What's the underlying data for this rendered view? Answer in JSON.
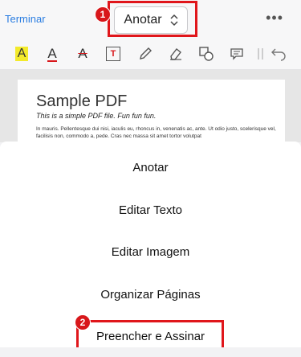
{
  "topbar": {
    "done_label": "Terminar",
    "mode_label": "Anotar",
    "more_label": "•••"
  },
  "toolbar": {
    "tools": [
      "highlight-icon",
      "text-color-icon",
      "strikethrough-icon",
      "text-box-icon",
      "pencil-icon",
      "eraser-icon",
      "shapes-icon",
      "comment-icon",
      "divider",
      "undo-icon"
    ],
    "highlight_glyph": "A",
    "text_color_glyph": "A",
    "strike_glyph": "A",
    "textbox_glyph": "T"
  },
  "document": {
    "title": "Sample PDF",
    "subtitle": "This is a simple PDF file. Fun fun fun.",
    "body": "In mauris. Pellentesque dui nisi, iaculis eu, rhoncus in, venenatis ac, ante. Ut odio justo, scelerisque vel, facilisis non, commodo a, pede. Cras nec massa sit amet tortor volutpat"
  },
  "menu": {
    "items": [
      "Anotar",
      "Editar Texto",
      "Editar Imagem",
      "Organizar Páginas",
      "Preencher e Assinar"
    ]
  },
  "annotations": {
    "badge1": "1",
    "badge2": "2",
    "highlight_color": "#e0161b"
  },
  "colors": {
    "accent": "#2a7de1",
    "highlight_yellow": "#f3ea2b",
    "red_underline": "#d8171b"
  }
}
